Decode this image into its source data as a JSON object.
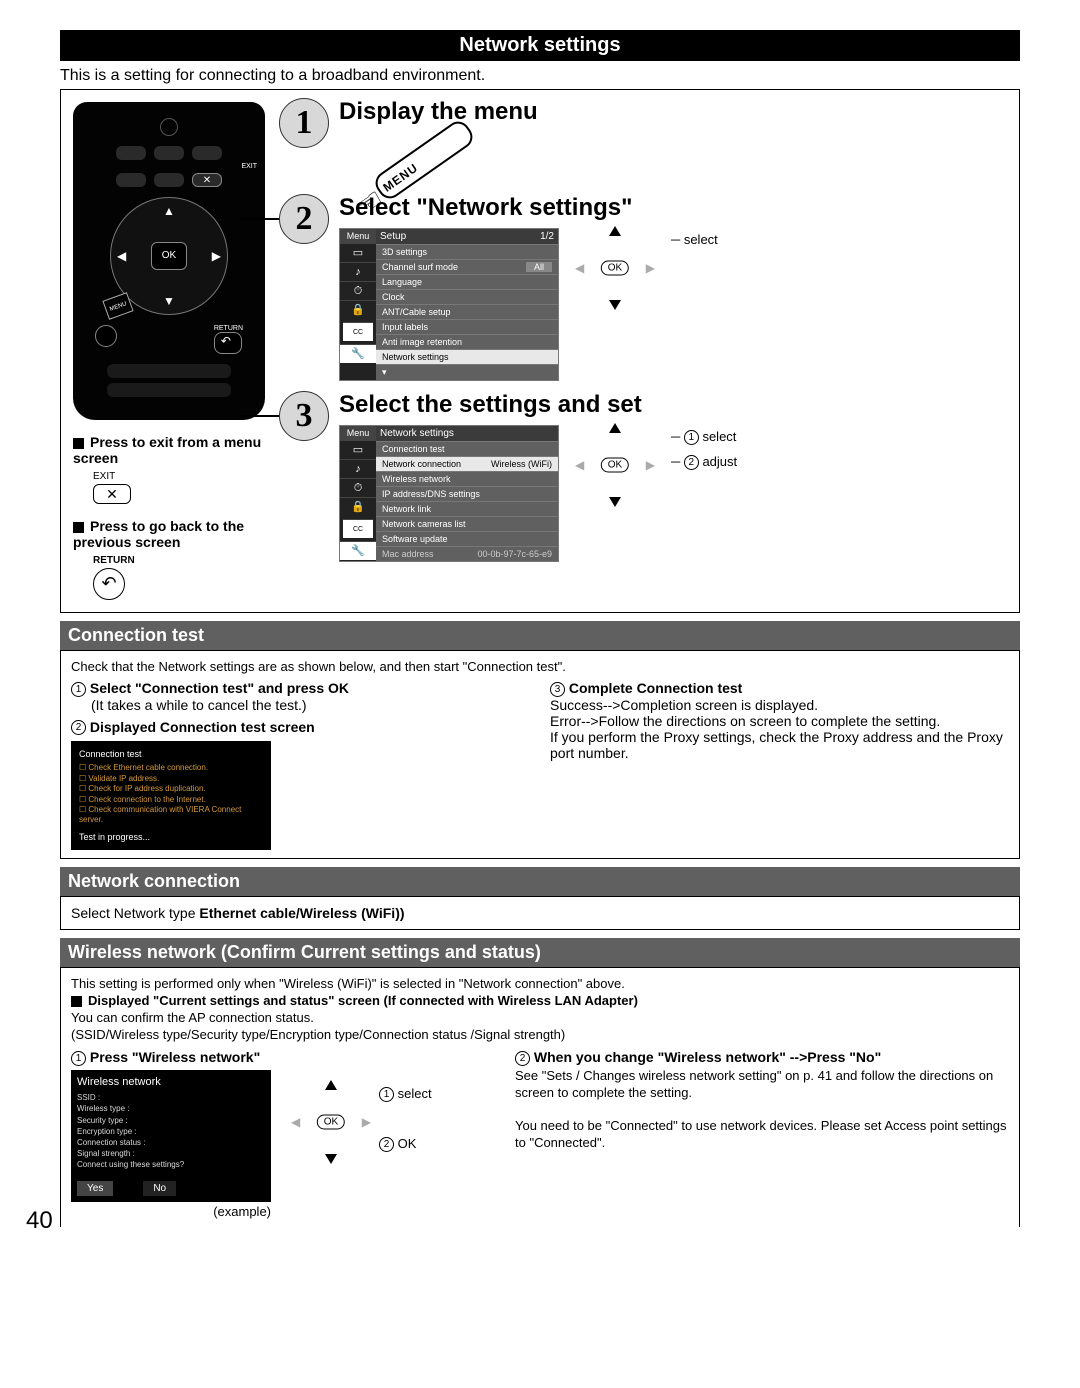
{
  "title_bar": "Network settings",
  "intro": "This is a setting for connecting to a broadband environment.",
  "remote": {
    "exit_label": "EXIT",
    "ok_label": "OK",
    "return_label": "RETURN",
    "menu_label": "MENU"
  },
  "notes": {
    "exit": {
      "heading": "Press to exit from a menu screen",
      "button_label": "EXIT",
      "icon": "✕"
    },
    "return": {
      "heading": "Press to go back to the previous screen",
      "button_label": "RETURN",
      "icon": "↶"
    }
  },
  "steps": {
    "s1": {
      "num": "1",
      "title": "Display the menu",
      "menu_button": "MENU"
    },
    "s2": {
      "num": "2",
      "title": "Select \"Network settings\"",
      "osd_side_header": "Menu",
      "osd_main_header": "Setup",
      "osd_page": "1/2",
      "rows": [
        "3D settings",
        "Channel surf mode",
        "Language",
        "Clock",
        "ANT/Cable setup",
        "Input labels",
        "Anti image retention",
        "Network settings"
      ],
      "surf_value": "All",
      "dpad_label": "select"
    },
    "s3": {
      "num": "3",
      "title": "Select the settings and set",
      "osd_side_header": "Menu",
      "osd_main_header": "Network settings",
      "rows": [
        "Connection test",
        "Network connection",
        "Wireless network",
        "IP address/DNS settings",
        "Network link",
        "Network cameras list",
        "Software update",
        "Mac address"
      ],
      "net_conn_value": "Wireless (WiFi)",
      "mac_value": "00-0b-97-7c-65-e9",
      "dpad_label1": "select",
      "dpad_label2": "adjust"
    }
  },
  "connection_test": {
    "header": "Connection test",
    "intro": "Check that the Network settings are as shown below, and then start \"Connection test\".",
    "step1_title": "Select \"Connection test\" and press OK",
    "step1_note": "(It takes a while to cancel the test.)",
    "step2_title": "Displayed Connection test screen",
    "screen": {
      "header": "Connection test",
      "lines": [
        "Check Ethernet cable connection.",
        "Validate IP address.",
        "Check for IP address duplication.",
        "Check connection to the Internet.",
        "Check communication with VIERA Connect server."
      ],
      "progress": "Test in progress..."
    },
    "step3_title": "Complete Connection test",
    "step3_body": "Success-->Completion screen is displayed.\nError-->Follow the directions on screen to complete the setting.\nIf you perform the Proxy settings, check the Proxy address and the Proxy port number."
  },
  "network_connection": {
    "header": "Network connection",
    "body_prefix": "Select Network type ",
    "body_bold": "Ethernet cable/Wireless (WiFi))"
  },
  "wireless": {
    "header": "Wireless network (Confirm Current settings and status)",
    "line1": "This setting is performed only when \"Wireless (WiFi)\" is selected in \"Network connection\" above.",
    "line2_bold": "Displayed \"Current settings and status\" screen (If connected with Wireless LAN Adapter)",
    "line3": "You can confirm the AP connection status.",
    "line4": "(SSID/Wireless type/Security type/Encryption type/Connection status /Signal strength)",
    "step1_title": "Press \"Wireless network\"",
    "screen": {
      "header": "Wireless network",
      "rows": [
        "SSID :",
        "Wireless type :",
        "Security type :",
        "Encryption type :",
        "Connection status :",
        "Signal strength :",
        "Connect using these settings?"
      ],
      "yes": "Yes",
      "no": "No"
    },
    "example": "(example)",
    "dpad_label1": "select",
    "dpad_label2": "OK",
    "step2_title": "When you change \"Wireless network\" -->Press \"No\"",
    "step2_body1": "See \"Sets / Changes wireless network setting\" on p. 41 and follow the directions on screen to complete the setting.",
    "step2_body2": "You need to be \"Connected\" to use network devices. Please set Access point settings to \"Connected\"."
  },
  "page_number": "40"
}
